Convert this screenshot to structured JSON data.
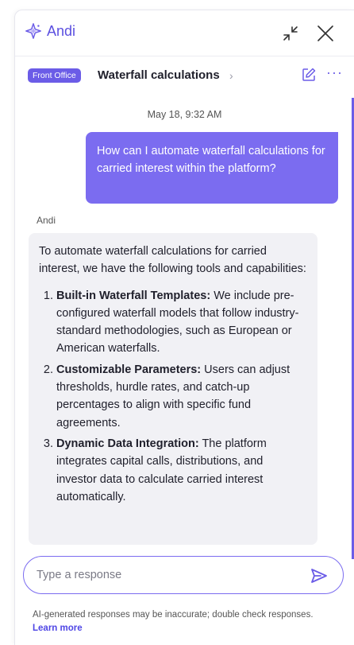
{
  "header": {
    "brand_name": "Andi",
    "brand_icon": "sparkle-logo-icon",
    "collapse_icon": "collapse-icon",
    "close_icon": "close-icon"
  },
  "thread": {
    "tag": "Front Office",
    "title": "Waterfall calculations",
    "chevron": "›",
    "edit_icon": "edit-icon",
    "more_icon": "more-icon",
    "more_label": "···"
  },
  "conversation": {
    "timestamp": "May 18, 9:32 AM",
    "user_message": "How can I automate waterfall calculations for carried interest within the platform?",
    "assistant_name": "Andi",
    "assistant_intro": "To automate waterfall calculations for carried interest, we have the following tools and capabilities:",
    "assistant_points": [
      {
        "title": "Built-in Waterfall Templates:",
        "text": " We include pre-configured waterfall models that follow industry-standard methodologies, such as European or American waterfalls."
      },
      {
        "title": "Customizable Parameters:",
        "text": " Users can adjust thresholds, hurdle rates, and catch-up percentages to align with specific fund agreements."
      },
      {
        "title": "Dynamic Data Integration:",
        "text": " The platform integrates capital calls, distributions, and investor data to calculate carried interest automatically."
      }
    ]
  },
  "composer": {
    "placeholder": "Type a response",
    "send_icon": "send-icon"
  },
  "footer": {
    "disclaimer": "AI-generated responses may be inaccurate; double check responses. ",
    "learn_more": "Learn more"
  },
  "colors": {
    "accent": "#6b5ce7",
    "user_bubble": "#7b6cf0",
    "bot_bubble": "#f1f1f5"
  }
}
